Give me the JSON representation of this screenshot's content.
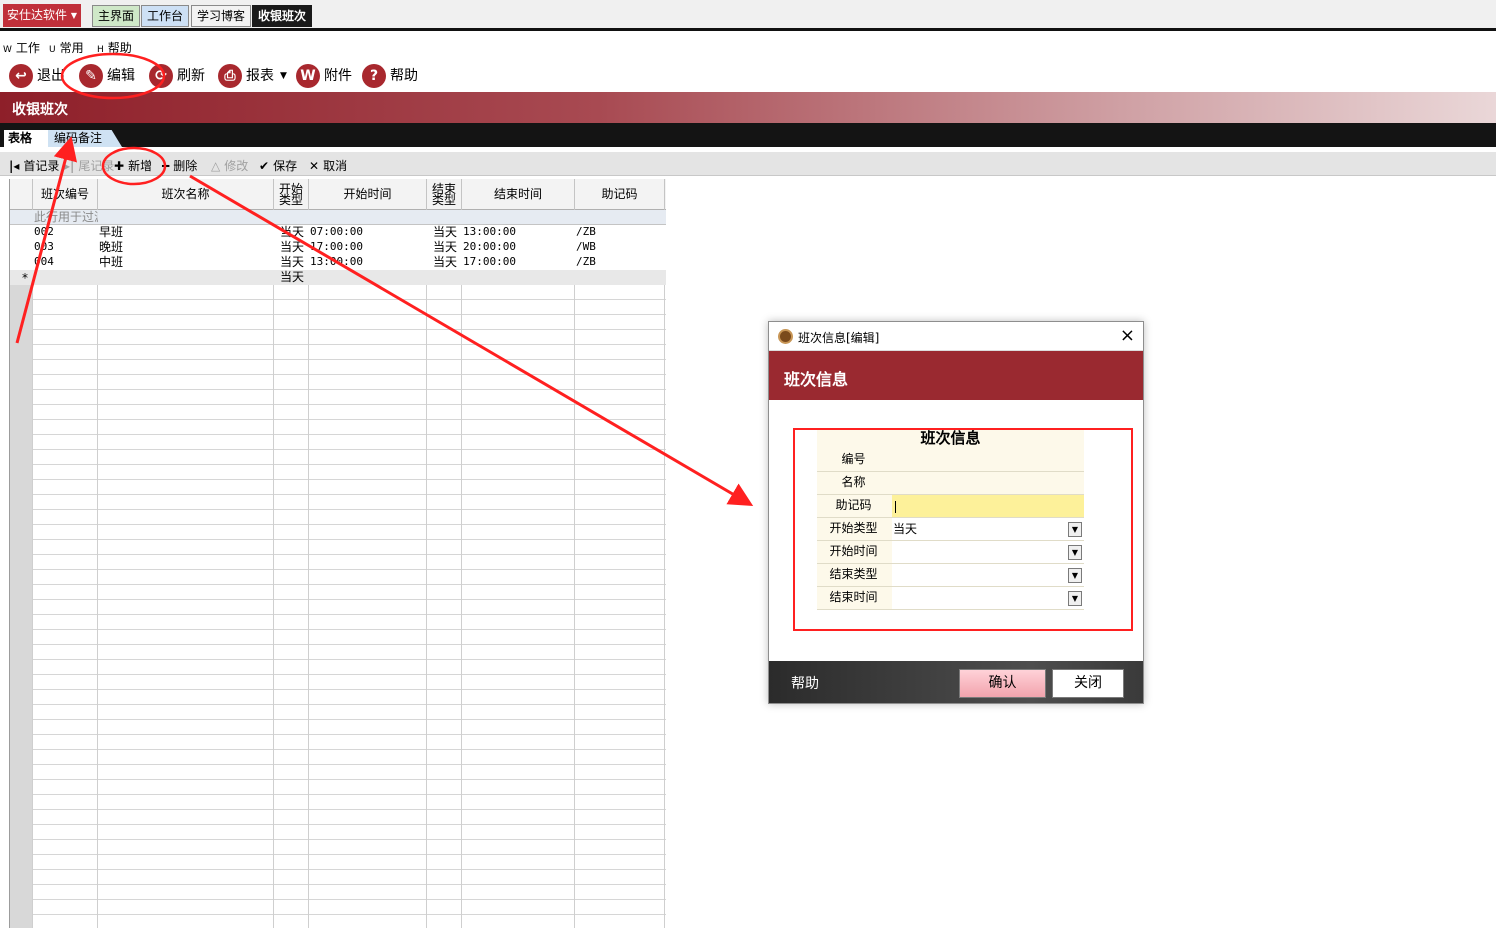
{
  "top_tabs": {
    "brand": "安仕达软件",
    "main": "主界面",
    "workbench": "工作台",
    "blog": "学习博客",
    "cashier_shift": "收银班次"
  },
  "menubar": {
    "work": {
      "accel": "W",
      "label": "工作"
    },
    "common": {
      "accel": "U",
      "label": "常用"
    },
    "help": {
      "accel": "H",
      "label": "帮助"
    }
  },
  "toolbar": {
    "exit": "退出",
    "edit": "编辑",
    "refresh": "刷新",
    "report": "报表",
    "attachment": "附件",
    "help": "帮助"
  },
  "page_title": "收银班次",
  "subtabs": {
    "table": "表格",
    "code_note": "编码备注"
  },
  "record_bar": {
    "first": "首记录",
    "last": "尾记录",
    "add": "新增",
    "delete": "删除",
    "modify": "修改",
    "save": "保存",
    "cancel": "取消"
  },
  "grid": {
    "headers": {
      "code": "班次编号",
      "name": "班次名称",
      "start_type": "开始类型",
      "start_time": "开始时间",
      "end_type": "结束类型",
      "end_time": "结束时间",
      "mnemonic": "助记码"
    },
    "filter_placeholder": "此行用于过滤",
    "rows": [
      {
        "code": "002",
        "name": "早班",
        "start_type": "当天",
        "start_time": "07:00:00",
        "end_type": "当天",
        "end_time": "13:00:00",
        "mnemonic": "/ZB"
      },
      {
        "code": "003",
        "name": "晚班",
        "start_type": "当天",
        "start_time": "17:00:00",
        "end_type": "当天",
        "end_time": "20:00:00",
        "mnemonic": "/WB"
      },
      {
        "code": "004",
        "name": "中班",
        "start_type": "当天",
        "start_time": "13:00:00",
        "end_type": "当天",
        "end_time": "17:00:00",
        "mnemonic": "/ZB"
      }
    ],
    "new_row": {
      "marker": "*",
      "start_type": "当天"
    }
  },
  "dialog": {
    "title": "班次信息[编辑]",
    "close": "×",
    "header": "班次信息",
    "form_title": "班次信息",
    "fields": {
      "code": {
        "label": "编号",
        "value": ""
      },
      "name": {
        "label": "名称",
        "value": ""
      },
      "mnemonic": {
        "label": "助记码",
        "value": ""
      },
      "start_type": {
        "label": "开始类型",
        "value": "当天"
      },
      "start_time": {
        "label": "开始时间",
        "value": ""
      },
      "end_type": {
        "label": "结束类型",
        "value": ""
      },
      "end_time": {
        "label": "结束时间",
        "value": ""
      }
    },
    "help": "帮助",
    "confirm": "确认",
    "close_button": "关闭"
  },
  "colors": {
    "brand_red": "#9a2930",
    "annotation_red": "#ff2020",
    "highlight_yellow": "#fdf19a"
  }
}
